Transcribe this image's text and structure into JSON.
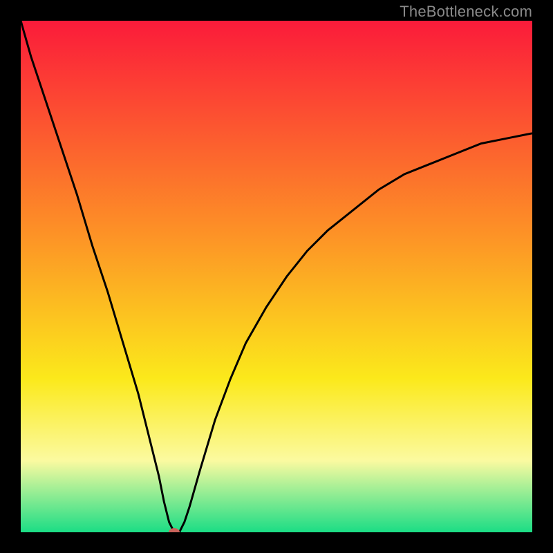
{
  "watermark": "TheBottleneck.com",
  "colors": {
    "top": "#fb1b3a",
    "mid1": "#fd9326",
    "mid2": "#fbe91b",
    "mid3": "#fbfaa0",
    "bottom": "#1bdd85",
    "curve": "#000000",
    "marker": "#c9635b",
    "frame": "#000000"
  },
  "chart_data": {
    "type": "line",
    "title": "",
    "xlabel": "",
    "ylabel": "",
    "xlim": [
      0,
      100
    ],
    "ylim": [
      0,
      100
    ],
    "x": [
      0,
      2,
      5,
      8,
      11,
      14,
      17,
      20,
      23,
      25,
      27,
      28,
      29,
      30,
      31,
      32,
      33,
      35,
      38,
      41,
      44,
      48,
      52,
      56,
      60,
      65,
      70,
      75,
      80,
      85,
      90,
      95,
      100
    ],
    "values": [
      100,
      93,
      84,
      75,
      66,
      56,
      47,
      37,
      27,
      19,
      11,
      6,
      2,
      0,
      0,
      2,
      5,
      12,
      22,
      30,
      37,
      44,
      50,
      55,
      59,
      63,
      67,
      70,
      72,
      74,
      76,
      77,
      78
    ],
    "marker": {
      "x": 30,
      "y": 0
    }
  }
}
